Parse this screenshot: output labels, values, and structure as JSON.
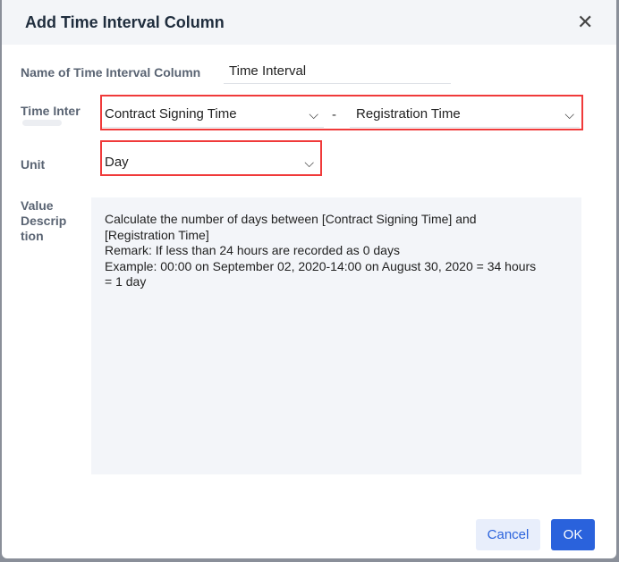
{
  "dialog": {
    "title": "Add Time Interval Column",
    "close_icon": "close-icon"
  },
  "form": {
    "name_label": "Name of Time Interval Column",
    "name_value": "Time Interval",
    "interval_label": "Time Inter",
    "start_value": "Contract Signing Time",
    "separator": "-",
    "end_value": "Registration Time",
    "unit_label": "Unit",
    "unit_value": "Day",
    "desc_label_1": "Value",
    "desc_label_2": "Descrip",
    "desc_label_3": "tion",
    "desc_lines": [
      "Calculate the number of days between [Contract Signing Time] and",
      "[Registration Time]",
      "Remark: If less than 24 hours are recorded as 0 days",
      "Example: 00:00 on September 02, 2020-14:00 on August 30, 2020 = 34 hours",
      "= 1 day"
    ]
  },
  "footer": {
    "cancel": "Cancel",
    "ok": "OK"
  },
  "colors": {
    "primary": "#2a62dc",
    "highlight": "#f03a3a"
  }
}
